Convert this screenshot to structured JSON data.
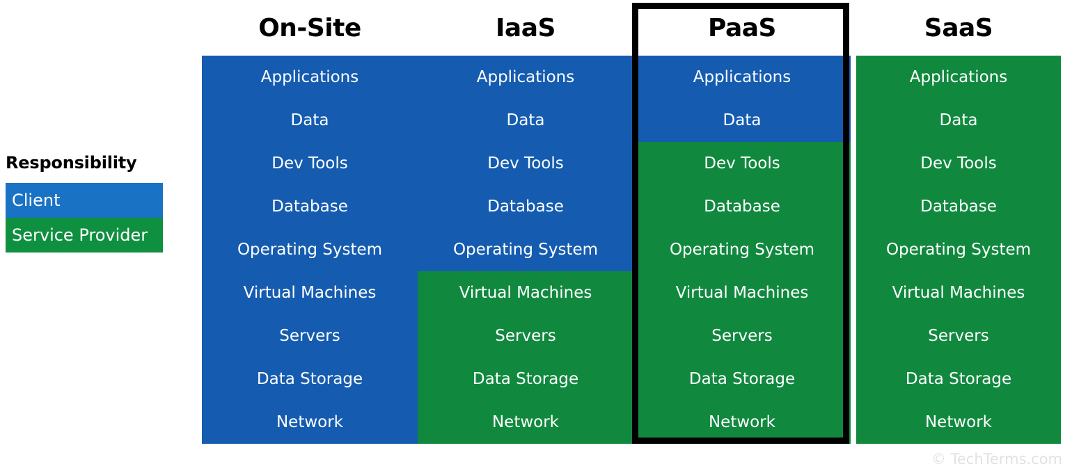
{
  "legend": {
    "title": "Responsibility",
    "items": [
      {
        "label": "Client",
        "color": "#1a72c4"
      },
      {
        "label": "Service Provider",
        "color": "#0f9040"
      }
    ]
  },
  "palette": {
    "client_blue": "#155cb0",
    "provider_green": "#10893e",
    "legend_client_blue": "#1a72c4",
    "legend_provider_green": "#0f9040",
    "highlight_border": "#000000",
    "text_on_color": "#ffffff",
    "header_text": "#000000",
    "copyright_text": "#e2e2e2",
    "background": "#ffffff"
  },
  "rows": [
    "Applications",
    "Data",
    "Dev Tools",
    "Database",
    "Operating System",
    "Virtual Machines",
    "Servers",
    "Data Storage",
    "Network"
  ],
  "columns": [
    {
      "header": "On-Site",
      "highlighted": false,
      "client_rows": 9,
      "cells": [
        {
          "label": "Applications",
          "owner": "Client"
        },
        {
          "label": "Data",
          "owner": "Client"
        },
        {
          "label": "Dev Tools",
          "owner": "Client"
        },
        {
          "label": "Database",
          "owner": "Client"
        },
        {
          "label": "Operating System",
          "owner": "Client"
        },
        {
          "label": "Virtual Machines",
          "owner": "Client"
        },
        {
          "label": "Servers",
          "owner": "Client"
        },
        {
          "label": "Data Storage",
          "owner": "Client"
        },
        {
          "label": "Network",
          "owner": "Client"
        }
      ]
    },
    {
      "header": "IaaS",
      "highlighted": false,
      "client_rows": 5,
      "cells": [
        {
          "label": "Applications",
          "owner": "Client"
        },
        {
          "label": "Data",
          "owner": "Client"
        },
        {
          "label": "Dev Tools",
          "owner": "Client"
        },
        {
          "label": "Database",
          "owner": "Client"
        },
        {
          "label": "Operating System",
          "owner": "Client"
        },
        {
          "label": "Virtual Machines",
          "owner": "Service Provider"
        },
        {
          "label": "Servers",
          "owner": "Service Provider"
        },
        {
          "label": "Data Storage",
          "owner": "Service Provider"
        },
        {
          "label": "Network",
          "owner": "Service Provider"
        }
      ]
    },
    {
      "header": "PaaS",
      "highlighted": true,
      "client_rows": 2,
      "cells": [
        {
          "label": "Applications",
          "owner": "Client"
        },
        {
          "label": "Data",
          "owner": "Client"
        },
        {
          "label": "Dev Tools",
          "owner": "Service Provider"
        },
        {
          "label": "Database",
          "owner": "Service Provider"
        },
        {
          "label": "Operating System",
          "owner": "Service Provider"
        },
        {
          "label": "Virtual Machines",
          "owner": "Service Provider"
        },
        {
          "label": "Servers",
          "owner": "Service Provider"
        },
        {
          "label": "Data Storage",
          "owner": "Service Provider"
        },
        {
          "label": "Network",
          "owner": "Service Provider"
        }
      ]
    },
    {
      "header": "SaaS",
      "highlighted": false,
      "client_rows": 0,
      "cells": [
        {
          "label": "Applications",
          "owner": "Service Provider"
        },
        {
          "label": "Data",
          "owner": "Service Provider"
        },
        {
          "label": "Dev Tools",
          "owner": "Service Provider"
        },
        {
          "label": "Database",
          "owner": "Service Provider"
        },
        {
          "label": "Operating System",
          "owner": "Service Provider"
        },
        {
          "label": "Virtual Machines",
          "owner": "Service Provider"
        },
        {
          "label": "Servers",
          "owner": "Service Provider"
        },
        {
          "label": "Data Storage",
          "owner": "Service Provider"
        },
        {
          "label": "Network",
          "owner": "Service Provider"
        }
      ]
    }
  ],
  "footer": {
    "copyright": "© TechTerms.com"
  }
}
